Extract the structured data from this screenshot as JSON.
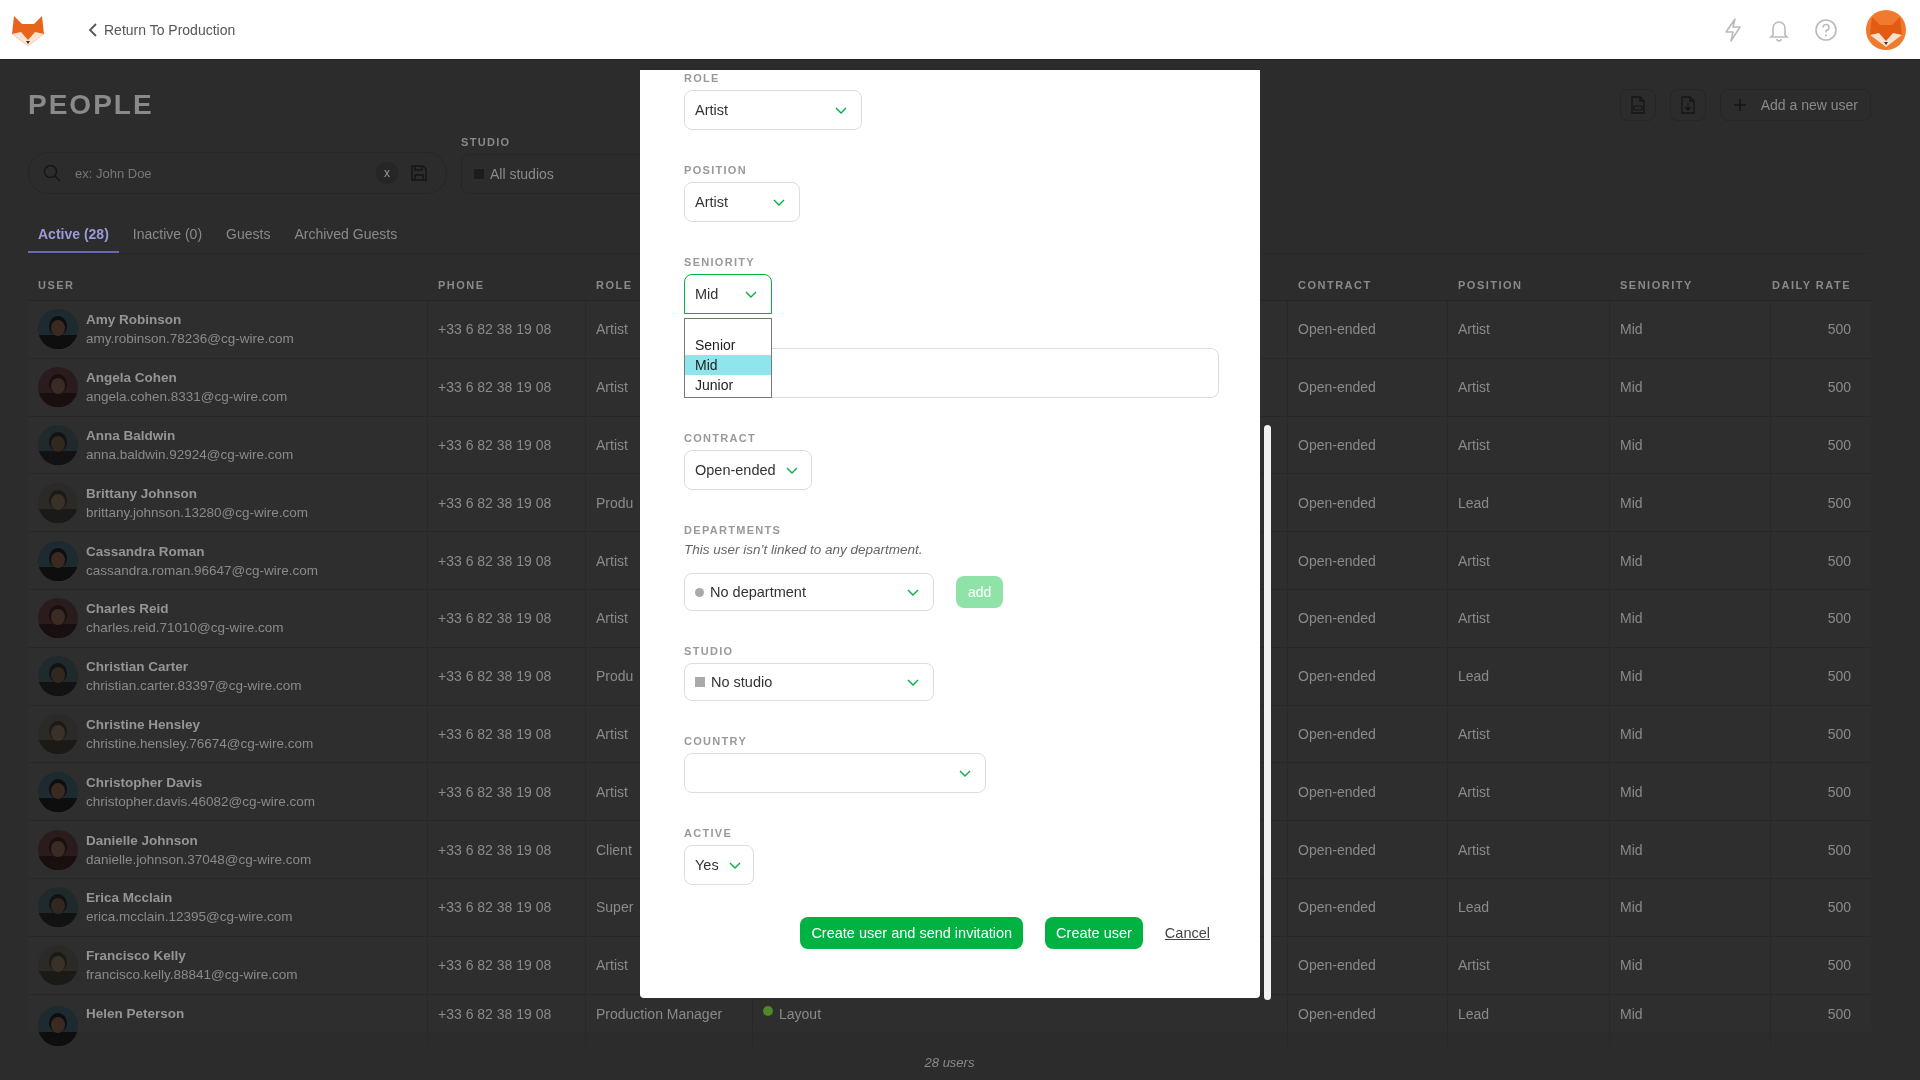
{
  "top_bar": {
    "back_link": "Return To Production"
  },
  "page": {
    "title": "PEOPLE",
    "search": {
      "placeholder": "ex: John Doe",
      "clear": "x"
    },
    "studio_filter": {
      "label": "STUDIO",
      "value": "All studios"
    },
    "add_button": "Add a new user",
    "tabs": [
      {
        "label": "Active (28)",
        "selected": true
      },
      {
        "label": "Inactive (0)",
        "selected": false
      },
      {
        "label": "Guests",
        "selected": false
      },
      {
        "label": "Archived Guests",
        "selected": false
      }
    ],
    "table": {
      "columns": [
        "USER",
        "PHONE",
        "ROLE",
        "CONTRACT",
        "POSITION",
        "SENIORITY",
        "DAILY RATE"
      ],
      "rows": [
        {
          "name": "Amy Robinson",
          "email": "amy.robinson.78236@cg-wire.com",
          "phone": "+33 6 82 38 19 08",
          "role": "Artist",
          "contract": "Open-ended",
          "position": "Artist",
          "seniority": "Mid",
          "daily_rate": "500"
        },
        {
          "name": "Angela Cohen",
          "email": "angela.cohen.8331@cg-wire.com",
          "phone": "+33 6 82 38 19 08",
          "role": "Artist",
          "contract": "Open-ended",
          "position": "Artist",
          "seniority": "Mid",
          "daily_rate": "500"
        },
        {
          "name": "Anna Baldwin",
          "email": "anna.baldwin.92924@cg-wire.com",
          "phone": "+33 6 82 38 19 08",
          "role": "Artist",
          "contract": "Open-ended",
          "position": "Artist",
          "seniority": "Mid",
          "daily_rate": "500"
        },
        {
          "name": "Brittany Johnson",
          "email": "brittany.johnson.13280@cg-wire.com",
          "phone": "+33 6 82 38 19 08",
          "role": "Produ",
          "contract": "Open-ended",
          "position": "Lead",
          "seniority": "Mid",
          "daily_rate": "500"
        },
        {
          "name": "Cassandra Roman",
          "email": "cassandra.roman.96647@cg-wire.com",
          "phone": "+33 6 82 38 19 08",
          "role": "Artist",
          "contract": "Open-ended",
          "position": "Artist",
          "seniority": "Mid",
          "daily_rate": "500"
        },
        {
          "name": "Charles Reid",
          "email": "charles.reid.71010@cg-wire.com",
          "phone": "+33 6 82 38 19 08",
          "role": "Artist",
          "contract": "Open-ended",
          "position": "Artist",
          "seniority": "Mid",
          "daily_rate": "500"
        },
        {
          "name": "Christian Carter",
          "email": "christian.carter.83397@cg-wire.com",
          "phone": "+33 6 82 38 19 08",
          "role": "Produ",
          "contract": "Open-ended",
          "position": "Lead",
          "seniority": "Mid",
          "daily_rate": "500"
        },
        {
          "name": "Christine Hensley",
          "email": "christine.hensley.76674@cg-wire.com",
          "phone": "+33 6 82 38 19 08",
          "role": "Artist",
          "contract": "Open-ended",
          "position": "Artist",
          "seniority": "Mid",
          "daily_rate": "500"
        },
        {
          "name": "Christopher Davis",
          "email": "christopher.davis.46082@cg-wire.com",
          "phone": "+33 6 82 38 19 08",
          "role": "Artist",
          "contract": "Open-ended",
          "position": "Artist",
          "seniority": "Mid",
          "daily_rate": "500"
        },
        {
          "name": "Danielle Johnson",
          "email": "danielle.johnson.37048@cg-wire.com",
          "phone": "+33 6 82 38 19 08",
          "role": "Client",
          "contract": "Open-ended",
          "position": "Artist",
          "seniority": "Mid",
          "daily_rate": "500"
        },
        {
          "name": "Erica Mcclain",
          "email": "erica.mcclain.12395@cg-wire.com",
          "phone": "+33 6 82 38 19 08",
          "role": "Super",
          "contract": "Open-ended",
          "position": "Lead",
          "seniority": "Mid",
          "daily_rate": "500"
        },
        {
          "name": "Francisco Kelly",
          "email": "francisco.kelly.88841@cg-wire.com",
          "phone": "+33 6 82 38 19 08",
          "role": "Artist",
          "contract": "Open-ended",
          "position": "Artist",
          "seniority": "Mid",
          "daily_rate": "500"
        },
        {
          "name": "Helen Peterson",
          "phone": "+33 6 82 38 19 08",
          "role": "Production Manager",
          "column_4": "Layout",
          "contract": "Open-ended",
          "position": "Lead",
          "seniority": "Mid",
          "daily_rate": "500"
        }
      ]
    },
    "footer": "28 users"
  },
  "modal": {
    "fields": [
      {
        "kind": "select",
        "label": "ROLE",
        "value": "Artist",
        "focused": false,
        "expanded": false
      },
      {
        "kind": "select",
        "label": "POSITION",
        "value": "Artist",
        "focused": false,
        "expanded": false
      },
      {
        "kind": "select",
        "label": "SENIORITY",
        "value": "Mid",
        "focused": true,
        "expanded": true,
        "options": [
          {
            "label": "Senior",
            "selected": false
          },
          {
            "label": "Mid",
            "selected": true
          },
          {
            "label": "Junior",
            "selected": false
          }
        ]
      },
      {
        "kind": "text"
      },
      {
        "kind": "select",
        "label": "CONTRACT",
        "value": "Open-ended",
        "focused": false,
        "expanded": false
      },
      {
        "kind": "departments",
        "label": "DEPARTMENTS",
        "note": "This user isn’t linked to any department.",
        "value": "No department",
        "button": "add",
        "button_disabled": true
      },
      {
        "kind": "studio",
        "label": "STUDIO",
        "value": "No studio"
      },
      {
        "kind": "select",
        "label": "COUNTRY",
        "focused": false,
        "expanded": false
      },
      {
        "kind": "select",
        "label": "ACTIVE",
        "value": "Yes",
        "focused": false,
        "expanded": false
      }
    ],
    "buttons": [
      {
        "kind": "primary",
        "label": "Create user and send invitation"
      },
      {
        "kind": "primary",
        "label": "Create user"
      },
      {
        "kind": "link",
        "label": "Cancel"
      }
    ]
  }
}
